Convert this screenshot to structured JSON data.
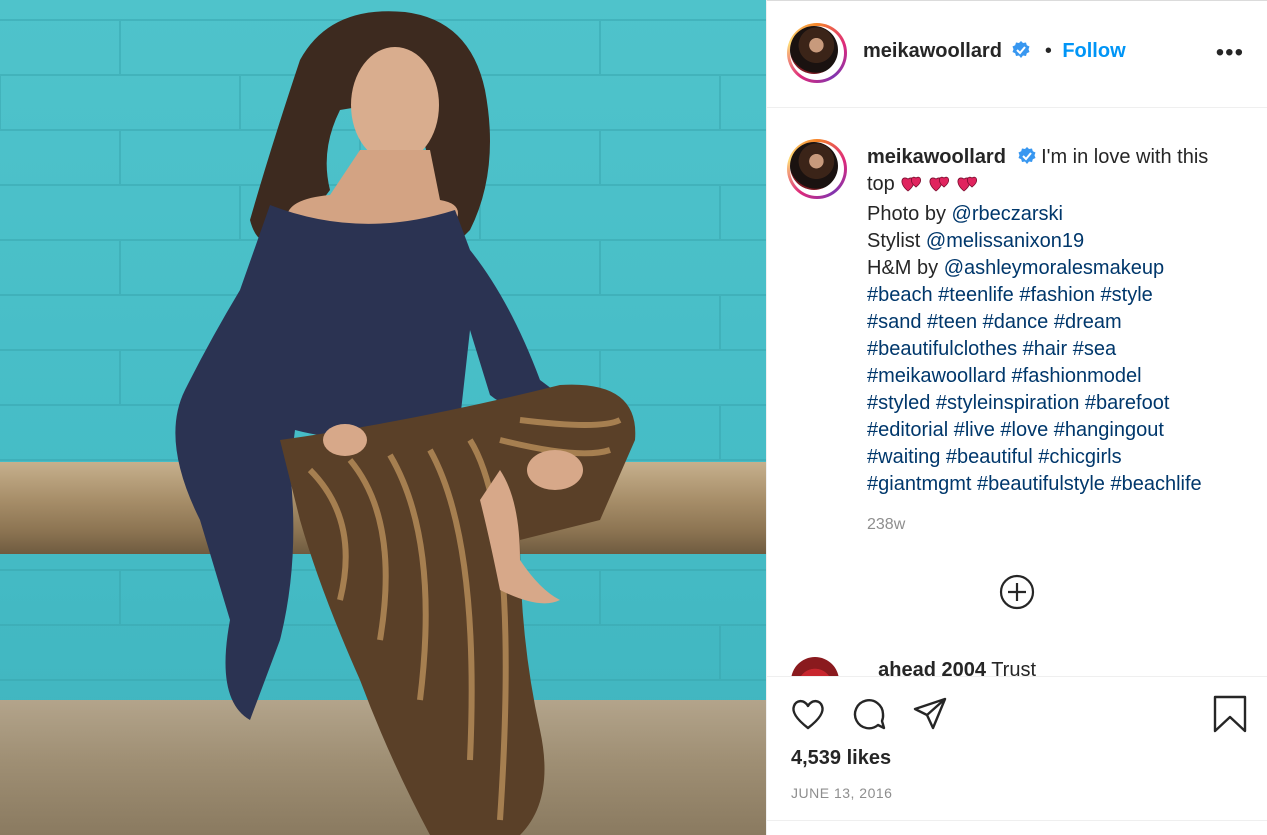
{
  "post": {
    "username": "meikawoollard",
    "verified": true,
    "dot": "•",
    "follow_label": "Follow",
    "more_label": "•••"
  },
  "caption": {
    "username": "meikawoollard",
    "text_line1": "I'm in love with this",
    "text_line2": "top",
    "hearts": [
      "two-hearts-emoji",
      "two-hearts-emoji",
      "two-hearts-emoji"
    ],
    "photo_prefix": "Photo by",
    "photo_mention": "@rbeczarski",
    "stylist_prefix": "Stylist",
    "stylist_mention": "@melissanixon19",
    "hm_prefix": "H&M by",
    "hm_mention": "@ashleymoralesmakeup",
    "hashtag_lines": [
      "#beach #teenlife #fashion #style",
      "#sand #teen #dance #dream",
      "#beautifulclothes #hair #sea",
      "#meikawoollard #fashionmodel",
      "#styled #styleinspiration #barefoot",
      "#editorial #live #love #hangingout",
      "#waiting #beautiful #chicgirls",
      "#giantmgmt #beautifulstyle #beachlife"
    ],
    "time_ago": "238w"
  },
  "comment_peek": {
    "username": "_ahead 2004",
    "text": "Trust"
  },
  "engagement": {
    "likes": "4,539 likes",
    "date": "JUNE 13, 2016"
  },
  "icons": {
    "like": "heart-icon",
    "comment": "comment-icon",
    "share": "share-icon",
    "save": "bookmark-icon",
    "load_more": "plus-circle-icon",
    "verified": "verified-badge-icon"
  },
  "colors": {
    "follow": "#0095f6",
    "link": "#00376b",
    "muted": "#8e8e8e",
    "verified": "#3897f0",
    "wall": "#4fc3cb"
  }
}
